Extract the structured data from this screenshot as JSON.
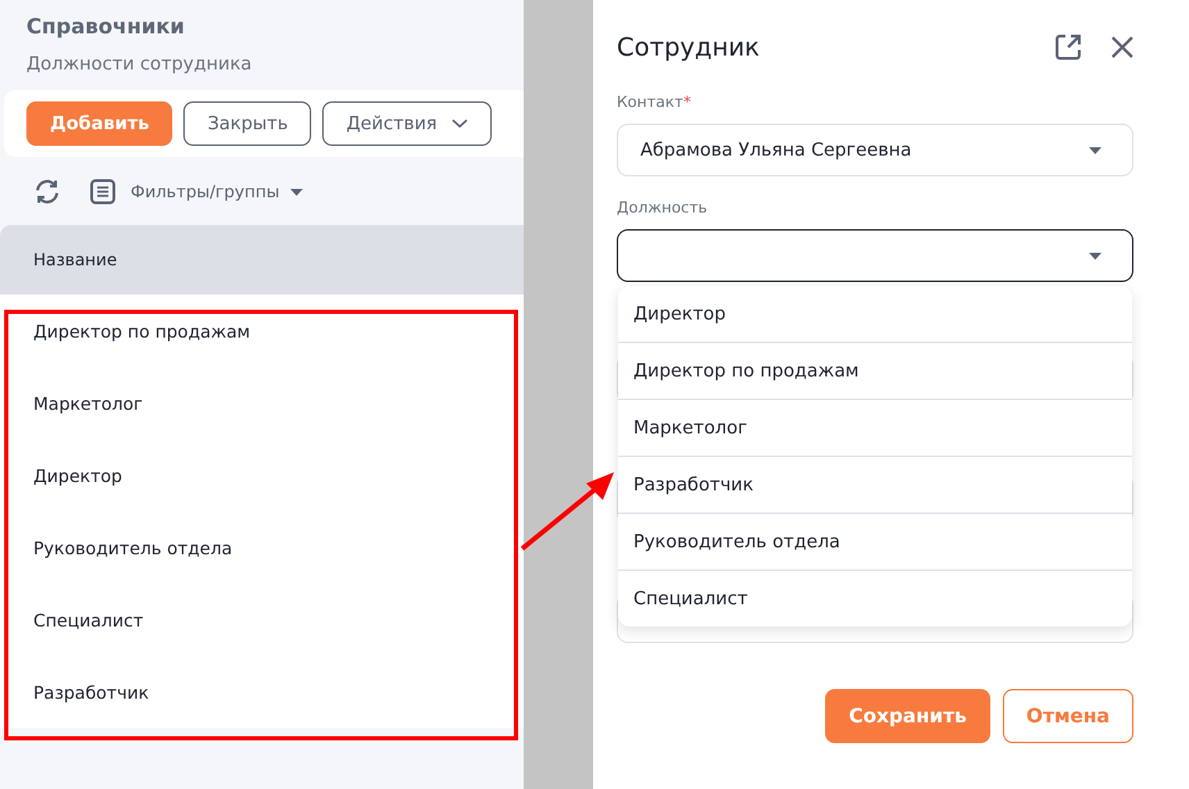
{
  "directory": {
    "title": "Справочники",
    "subtitle": "Должности сотрудника",
    "buttons": [
      {
        "label": "Добавить",
        "kind": "primary"
      },
      {
        "label": "Закрыть",
        "kind": "outline"
      },
      {
        "label": "Действия",
        "kind": "menu"
      }
    ],
    "filter": {
      "label": "Фильтры/группы"
    },
    "table": {
      "columns": [
        "Название"
      ],
      "rows": [
        "Директор по продажам",
        "Маркетолог",
        "Директор",
        "Руководитель отдела",
        "Специалист",
        "Разработчик"
      ]
    }
  },
  "form": {
    "title": "Сотрудник",
    "fields": [
      {
        "label": "Контакт",
        "required_mark": "*",
        "focused": false,
        "value": "Абрамова Ульяна Сергеевна"
      },
      {
        "label": "Должность",
        "focused": true,
        "expanded": true,
        "options": [
          "Директор",
          "Директор по продажам",
          "Маркетолог",
          "Разработчик",
          "Руководитель отдела",
          "Специалист"
        ]
      }
    ],
    "buttons": [
      {
        "label": "Сохранить",
        "kind": "primary"
      },
      {
        "label": "Отмена",
        "kind": "cancel"
      }
    ]
  }
}
